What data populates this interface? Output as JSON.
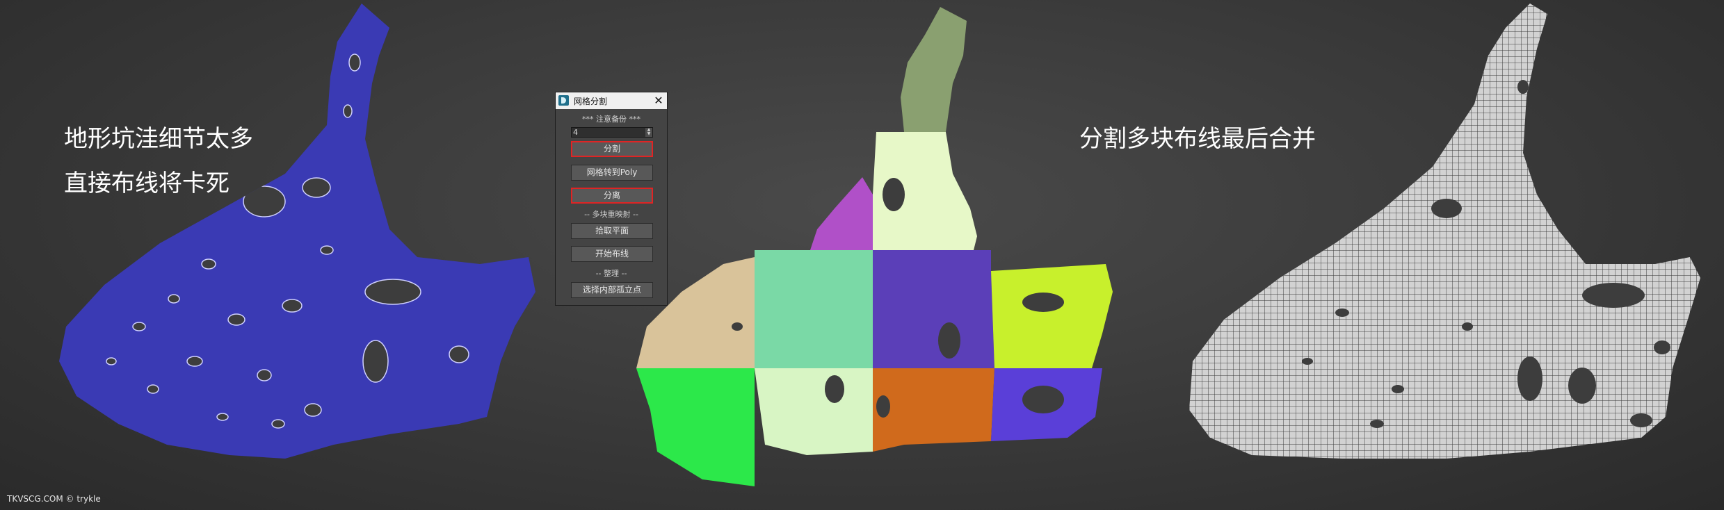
{
  "captions": {
    "left_line1": "地形坑洼细节太多",
    "left_line2": "直接布线将卡死",
    "right": "分割多块布线最后合并"
  },
  "watermark": "TKVSCG.COM © trykle",
  "dialog": {
    "title": "网格分割",
    "close_label": "✕",
    "section_backup": "*** 注意备份 ***",
    "split_count": "4",
    "buttons": {
      "split": "分割",
      "mesh_to_poly": "网格转到Poly",
      "detach": "分离"
    },
    "section_multi_map": "-- 多块重映射 --",
    "buttons2": {
      "extract_plane": "拾取平面",
      "start_retopo": "开始布线"
    },
    "section_cleanup": "-- 整理 --",
    "buttons3": {
      "select_isolated": "选择内部孤立点"
    }
  },
  "colors": {
    "left_mesh": "#3a3ab4",
    "right_mesh": "#d2d2d2",
    "grid_line": "#3a3a3a",
    "highlight_border": "#e02424",
    "tiles": [
      "#d9c39a",
      "#7ad9a6",
      "#5b3fb8",
      "#c8f02c",
      "#2ce84a",
      "#d8f5c4",
      "#d06a1c",
      "#5a3fd8",
      "#e7f8c8",
      "#8aa070",
      "#b050c8"
    ]
  }
}
